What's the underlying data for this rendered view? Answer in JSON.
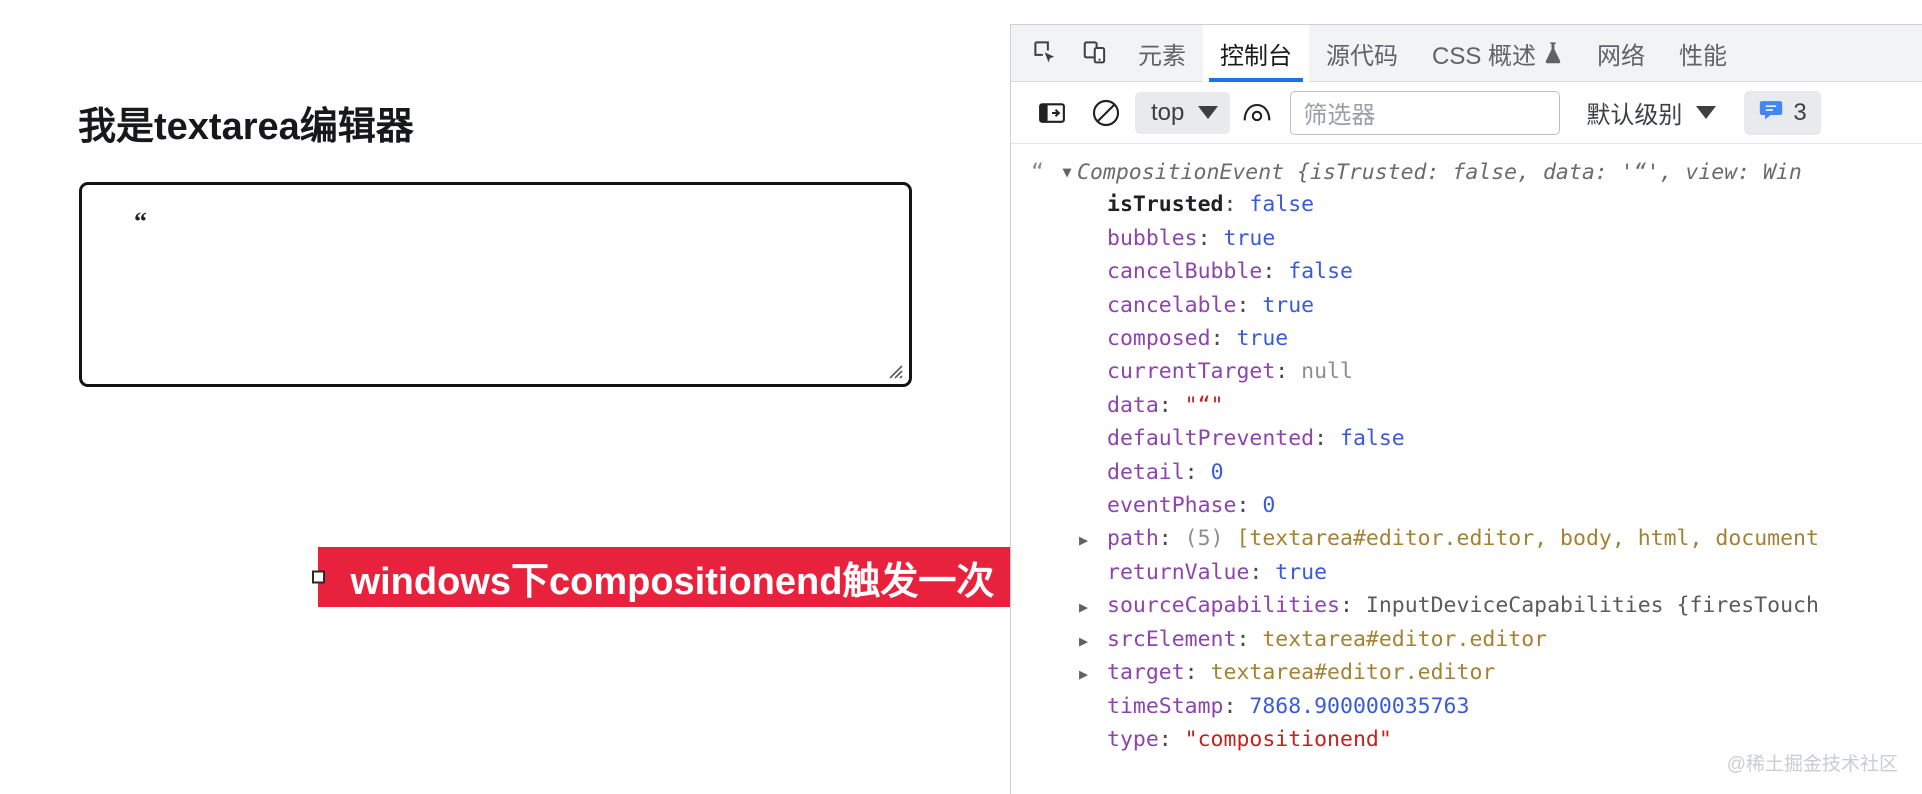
{
  "page": {
    "heading": "我是textarea编辑器",
    "editor": {
      "value": "“",
      "resize_grip": "resize-grip-icon"
    },
    "annotation": {
      "text": "windows下compositionend触发一次",
      "bg_color": "#e8213c",
      "text_color": "#ffffff"
    }
  },
  "devtools": {
    "toolbar_icons": [
      {
        "name": "inspect-element-icon"
      },
      {
        "name": "device-toolbar-icon"
      }
    ],
    "tabs": [
      {
        "label": "元素",
        "active": false
      },
      {
        "label": "控制台",
        "active": true
      },
      {
        "label": "源代码",
        "active": false
      },
      {
        "label": "CSS 概述",
        "active": false,
        "experimental": true
      },
      {
        "label": "网络",
        "active": false
      },
      {
        "label": "性能",
        "active": false
      }
    ],
    "active_tab_accent": "#1a73e8",
    "console_bar": {
      "sidebar_toggle_icon": "show-console-sidebar-icon",
      "clear_icon": "clear-console-icon",
      "context_selected": "top",
      "eye_icon": "live-expression-icon",
      "filter_placeholder": "筛选器",
      "filter_value": "",
      "level_label": "默认级别",
      "message_icon": "message-bubble-icon",
      "message_count": "3"
    },
    "console_log": {
      "quote": "“",
      "preview": "CompositionEvent {isTrusted: false, data: '“', view: Win",
      "properties": [
        {
          "expander": "none",
          "key": "isTrusted",
          "own": true,
          "value": "false",
          "kind": "bool"
        },
        {
          "expander": "none",
          "key": "bubbles",
          "own": false,
          "value": "true",
          "kind": "bool"
        },
        {
          "expander": "none",
          "key": "cancelBubble",
          "own": false,
          "value": "false",
          "kind": "bool"
        },
        {
          "expander": "none",
          "key": "cancelable",
          "own": false,
          "value": "true",
          "kind": "bool"
        },
        {
          "expander": "none",
          "key": "composed",
          "own": false,
          "value": "true",
          "kind": "bool"
        },
        {
          "expander": "none",
          "key": "currentTarget",
          "own": false,
          "value": "null",
          "kind": "null"
        },
        {
          "expander": "none",
          "key": "data",
          "own": false,
          "value": "\"“\"",
          "kind": "str"
        },
        {
          "expander": "none",
          "key": "defaultPrevented",
          "own": false,
          "value": "false",
          "kind": "bool"
        },
        {
          "expander": "none",
          "key": "detail",
          "own": false,
          "value": "0",
          "kind": "num"
        },
        {
          "expander": "none",
          "key": "eventPhase",
          "own": false,
          "value": "0",
          "kind": "num"
        },
        {
          "expander": "closed",
          "key": "path",
          "own": false,
          "count": "(5)",
          "value": "[textarea#editor.editor, body, html, document",
          "kind": "node"
        },
        {
          "expander": "none",
          "key": "returnValue",
          "own": false,
          "value": "true",
          "kind": "bool"
        },
        {
          "expander": "closed",
          "key": "sourceCapabilities",
          "own": false,
          "value": "InputDeviceCapabilities {firesTouch",
          "kind": "plain"
        },
        {
          "expander": "closed",
          "key": "srcElement",
          "own": false,
          "value": "textarea#editor.editor",
          "kind": "node"
        },
        {
          "expander": "closed",
          "key": "target",
          "own": false,
          "value": "textarea#editor.editor",
          "kind": "node"
        },
        {
          "expander": "none",
          "key": "timeStamp",
          "own": false,
          "value": "7868.900000035763",
          "kind": "num"
        },
        {
          "expander": "none",
          "key": "type",
          "own": false,
          "value": "\"compositionend\"",
          "kind": "str"
        }
      ]
    }
  },
  "watermark": "@稀土掘金技术社区"
}
